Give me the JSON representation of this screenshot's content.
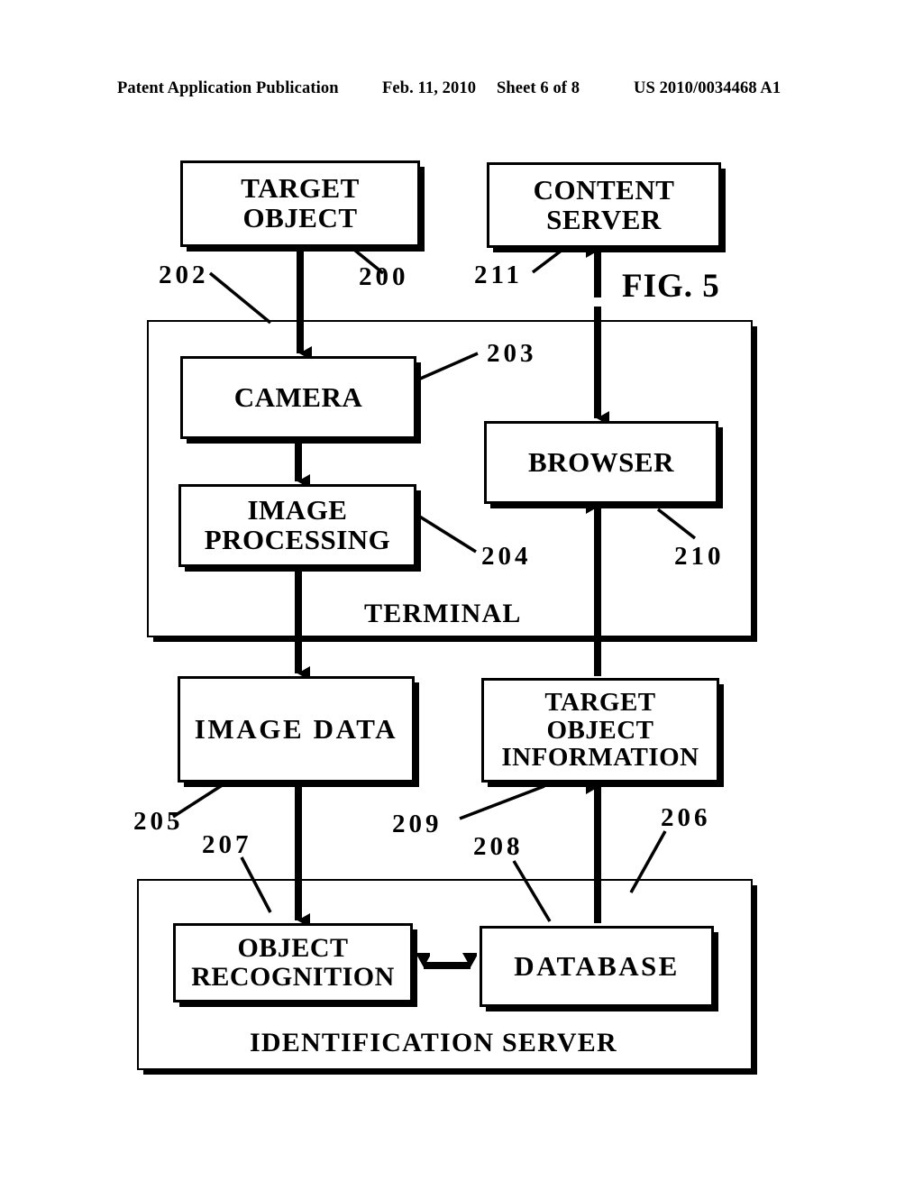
{
  "header": {
    "publication": "Patent Application Publication",
    "date": "Feb. 11, 2010",
    "sheet": "Sheet 6 of 8",
    "document_number": "US 2010/0034468 A1"
  },
  "figure": {
    "label": "FIG. 5",
    "nodes": {
      "target_object": "TARGET\nOBJECT",
      "content_server": "CONTENT\nSERVER",
      "camera": "CAMERA",
      "image_processing": "IMAGE\nPROCESSING",
      "browser": "BROWSER",
      "image_data": "IMAGE DATA",
      "target_object_information": "TARGET\nOBJECT\nINFORMATION",
      "object_recognition": "OBJECT\nRECOGNITION",
      "database": "DATABASE"
    },
    "containers": {
      "terminal": "TERMINAL",
      "identification_server": "IDENTIFICATION SERVER"
    },
    "reference_numerals": {
      "n200": "200",
      "n202": "202",
      "n203": "203",
      "n204": "204",
      "n205": "205",
      "n206": "206",
      "n207": "207",
      "n208": "208",
      "n209": "209",
      "n210": "210",
      "n211": "211"
    },
    "colors": {
      "ink": "#000000",
      "paper": "#ffffff"
    }
  }
}
